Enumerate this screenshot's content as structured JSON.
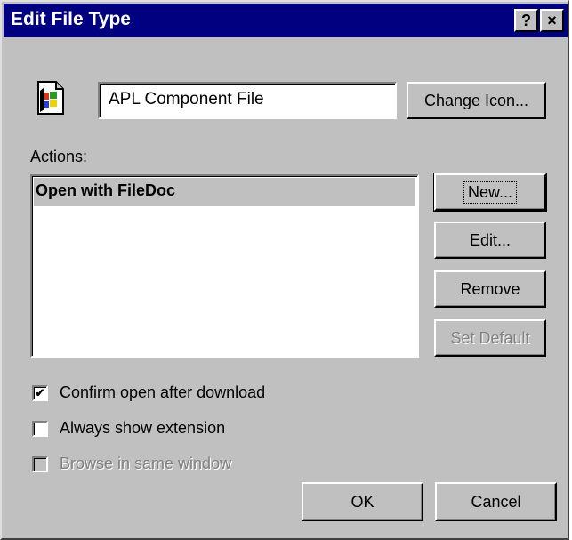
{
  "window": {
    "title": "Edit File Type",
    "help_button": "?",
    "close_button": "×"
  },
  "file_type": {
    "description": "APL Component File",
    "change_icon_label": "Change Icon..."
  },
  "actions": {
    "label": "Actions:",
    "items": [
      "Open with FileDoc"
    ],
    "selected_index": 0,
    "buttons": {
      "new": "New...",
      "edit": "Edit...",
      "remove": "Remove",
      "set_default": "Set Default"
    }
  },
  "options": [
    {
      "label": "Confirm open after download",
      "checked": true,
      "enabled": true
    },
    {
      "label": "Always show extension",
      "checked": false,
      "enabled": true
    },
    {
      "label": "Browse in same window",
      "checked": false,
      "enabled": false
    }
  ],
  "footer": {
    "ok_label": "OK",
    "cancel_label": "Cancel"
  },
  "colors": {
    "titlebar": "#000080",
    "face": "#c0c0c0",
    "disabled_text": "#808080"
  }
}
